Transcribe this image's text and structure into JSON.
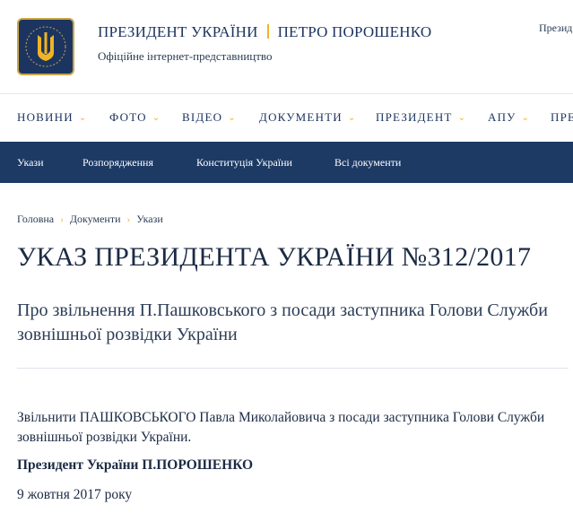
{
  "header": {
    "brand_left": "ПРЕЗИДЕНТ УКРАЇНИ",
    "brand_right": "ПЕТРО ПОРОШЕНКО",
    "subtitle": "Офіційне інтернет-представництво",
    "corner_text": "Презид"
  },
  "main_nav": {
    "items": [
      {
        "label": "НОВИНИ"
      },
      {
        "label": "ФОТО"
      },
      {
        "label": "ВІДЕО"
      },
      {
        "label": "ДОКУМЕНТИ"
      },
      {
        "label": "ПРЕЗИДЕНТ"
      },
      {
        "label": "АПУ"
      },
      {
        "label": "ПРЕ"
      }
    ]
  },
  "sub_nav": {
    "items": [
      {
        "label": "Укази"
      },
      {
        "label": "Розпорядження"
      },
      {
        "label": "Конституція України"
      },
      {
        "label": "Всі документи"
      }
    ]
  },
  "breadcrumb": {
    "items": [
      "Головна",
      "Документи",
      "Укази"
    ]
  },
  "document": {
    "title": "УКАЗ ПРЕЗИДЕНТА УКРАЇНИ №312/2017",
    "lead": "Про звільнення П.Пашковського з посади заступника Голови Служби зовнішньої розвідки України",
    "body": "Звільнити ПАШКОВСЬКОГО Павла Миколайовича з посади заступника Голови Служби зовнішньої розвідки України.",
    "signature": "Президент України П.ПОРОШЕНКО",
    "date": "9 жовтня 2017 року"
  },
  "colors": {
    "brand_navy": "#1d3a64",
    "accent_gold": "#f0b323",
    "text_dark": "#1c2b44"
  },
  "icons": {
    "logo": "trident-coat-of-arms-icon",
    "chevron": "chevron-down-icon",
    "breadcrumb_separator": "chevron-right-icon"
  }
}
